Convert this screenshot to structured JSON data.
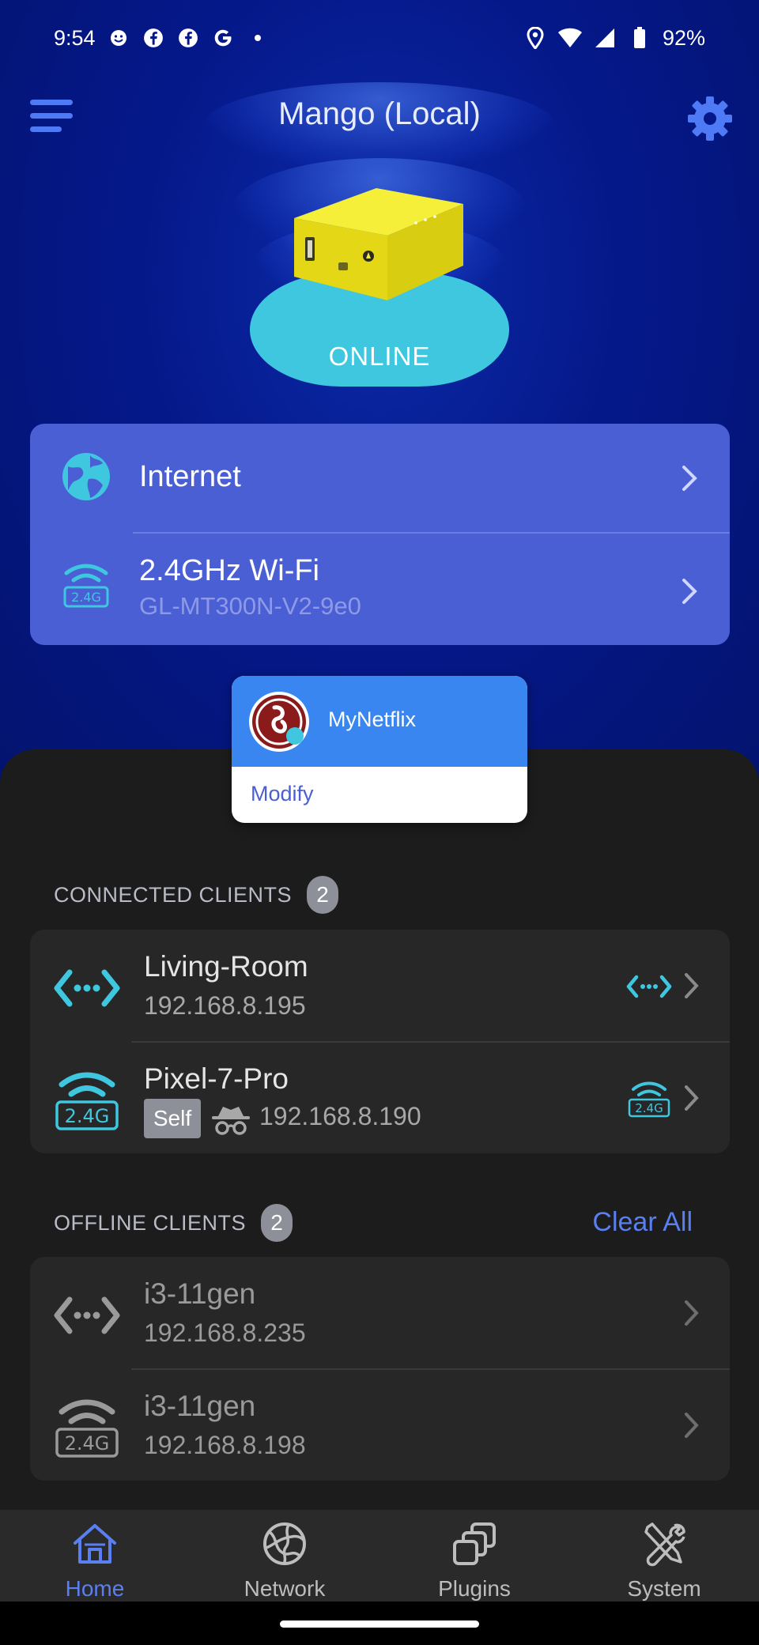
{
  "status_bar": {
    "time": "9:54",
    "battery": "92%",
    "notification_icons": [
      "smiley-icon",
      "facebook-icon",
      "facebook-icon",
      "google-icon",
      "dot-icon"
    ],
    "system_icons": [
      "location-icon",
      "wifi-icon",
      "signal-icon",
      "battery-icon"
    ]
  },
  "header": {
    "title": "Mango (Local)",
    "menu_icon": "hamburger-menu-icon",
    "settings_icon": "gear-icon"
  },
  "router_status": {
    "state": "ONLINE",
    "cloud_color": "#3fc7e0"
  },
  "connections": [
    {
      "title": "Internet",
      "subtitle": "",
      "icon": "globe-icon"
    },
    {
      "title": "2.4GHz Wi-Fi",
      "subtitle": "GL-MT300N-V2-9e0",
      "icon": "wifi-2.4g-icon"
    }
  ],
  "popup": {
    "title": "MyNetflix",
    "action": "Modify"
  },
  "connected_clients": {
    "label": "CONNECTED CLIENTS",
    "count": "2",
    "items": [
      {
        "name": "Living-Room",
        "ip": "192.168.8.195",
        "type": "ethernet"
      },
      {
        "name": "Pixel-7-Pro",
        "ip": "192.168.8.190",
        "type": "wifi-2.4g",
        "badge": "Self"
      }
    ]
  },
  "offline_clients": {
    "label": "OFFLINE CLIENTS",
    "count": "2",
    "clear_label": "Clear All",
    "items": [
      {
        "name": "i3-11gen",
        "ip": "192.168.8.235",
        "type": "ethernet"
      },
      {
        "name": "i3-11gen",
        "ip": "192.168.8.198",
        "type": "wifi-2.4g"
      }
    ]
  },
  "bottom_nav": {
    "items": [
      {
        "label": "Home",
        "icon": "home-icon",
        "active": true
      },
      {
        "label": "Network",
        "icon": "globe-icon",
        "active": false
      },
      {
        "label": "Plugins",
        "icon": "plugins-icon",
        "active": false
      },
      {
        "label": "System",
        "icon": "tools-icon",
        "active": false
      }
    ]
  },
  "colors": {
    "accent": "#5a7ff0",
    "card_blue": "#4a5fd4",
    "header_bg": "#05188a",
    "cyan": "#3fc7e0"
  }
}
